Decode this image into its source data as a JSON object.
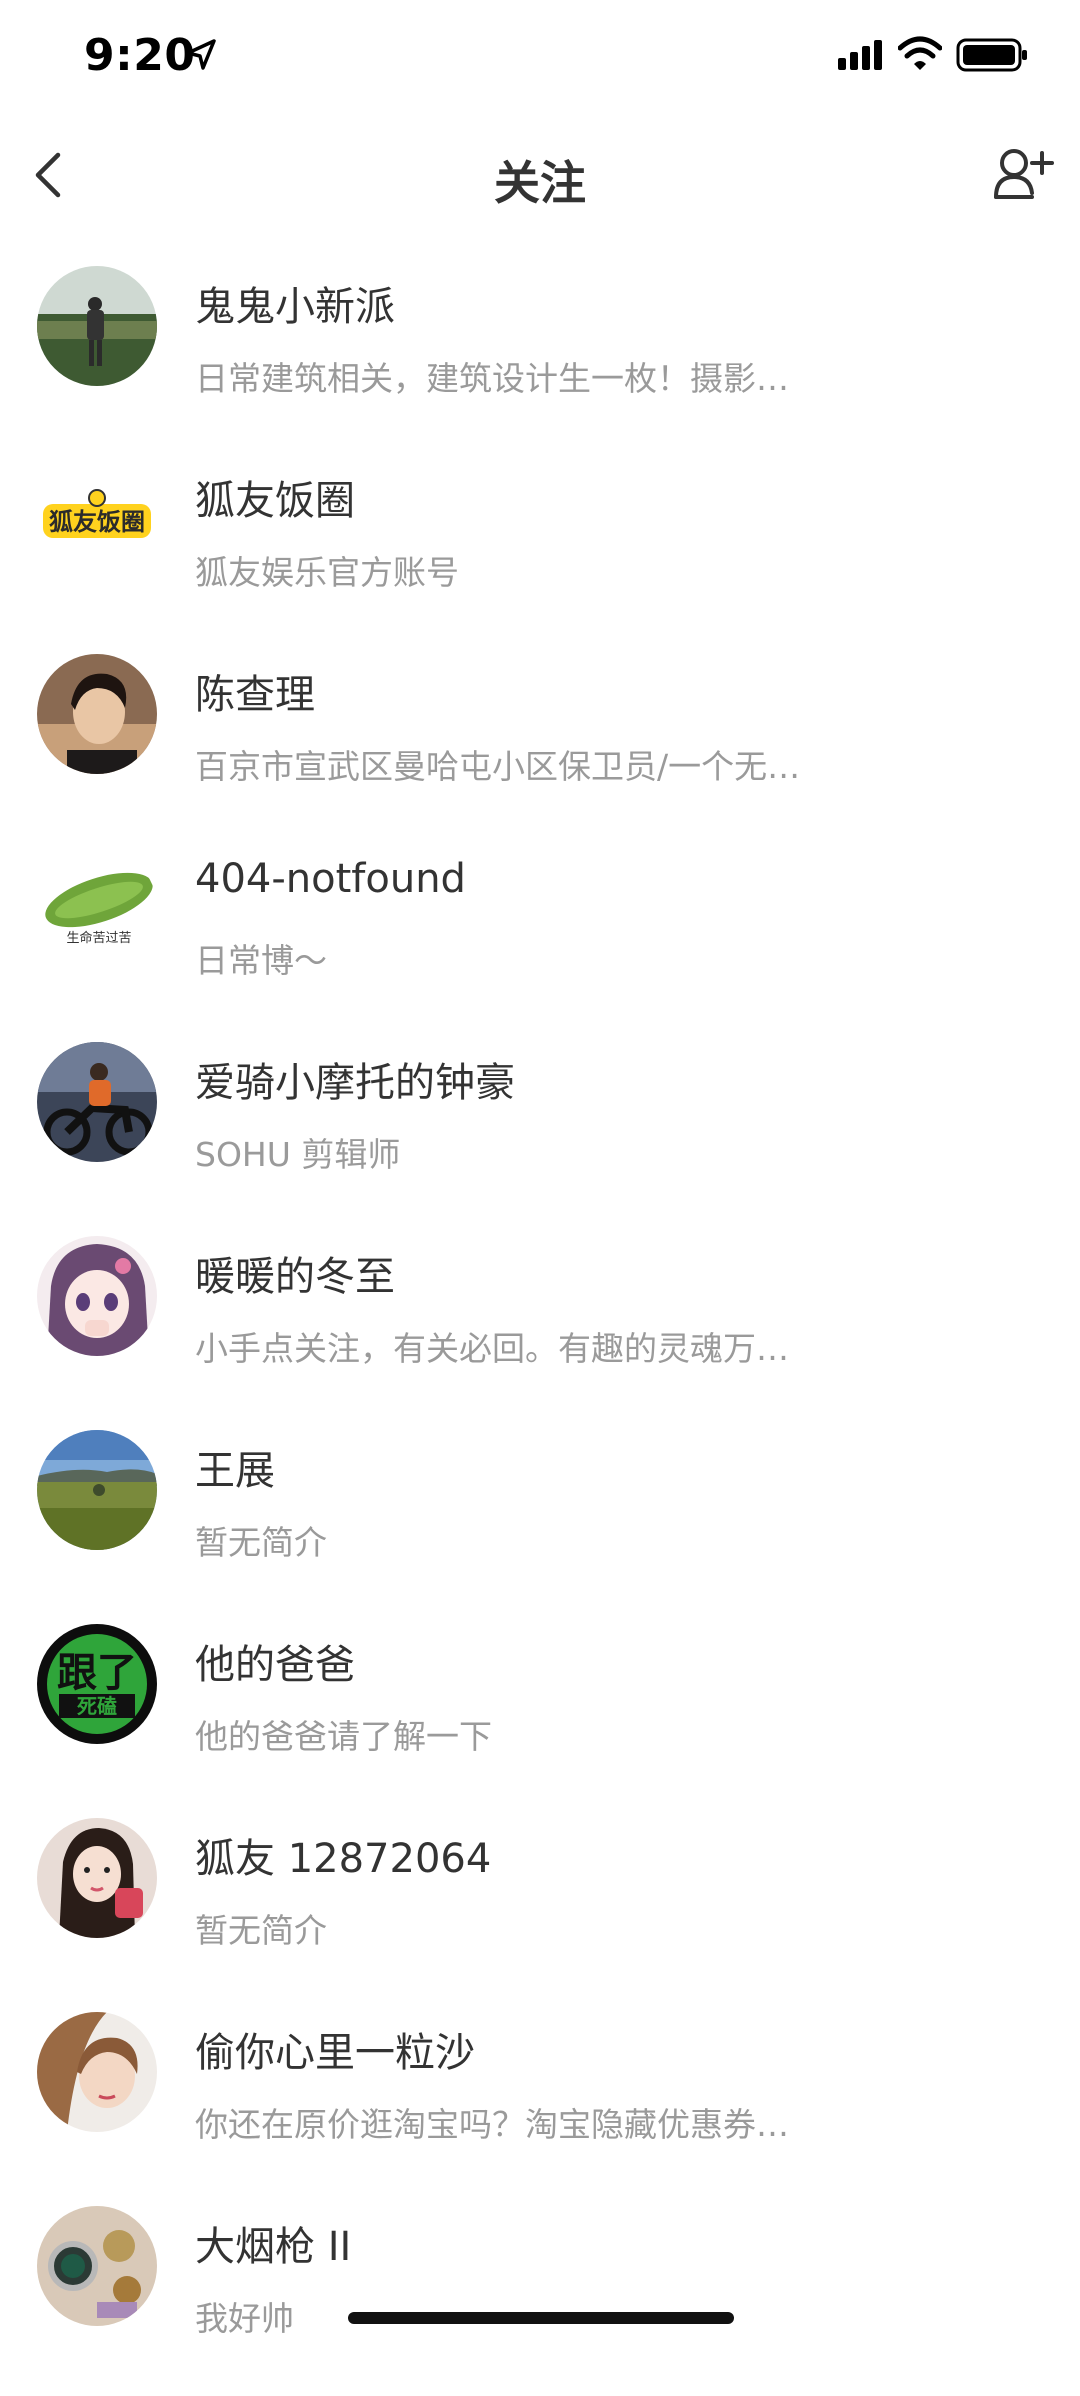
{
  "status_bar": {
    "time": "9:20"
  },
  "nav": {
    "title": "关注"
  },
  "follows": [
    {
      "name": "鬼鬼小新派",
      "bio": "日常建筑相关，建筑设计生一枚！摄影…",
      "avatar": "person-photo-avatar"
    },
    {
      "name": "狐友饭圈",
      "bio": "狐友娱乐官方账号",
      "avatar": "logo-avatar",
      "logo_text": "狐友饭圈"
    },
    {
      "name": "陈查理",
      "bio": "百京市宣武区曼哈屯小区保卫员/一个无…",
      "avatar": "portrait-avatar"
    },
    {
      "name": "404-notfound",
      "bio": "日常博～",
      "avatar": "bitter-melon-avatar",
      "avatar_caption": "生命苦过苦"
    },
    {
      "name": "爱骑小摩托的钟豪",
      "bio": "SOHU 剪辑师",
      "avatar": "motorcycle-avatar"
    },
    {
      "name": "暖暖的冬至",
      "bio": "小手点关注，有关必回。有趣的灵魂万…",
      "avatar": "anime-girl-avatar"
    },
    {
      "name": "王展",
      "bio": "暂无简介",
      "avatar": "landscape-avatar"
    },
    {
      "name": "他的爸爸",
      "bio": "他的爸爸请了解一下",
      "avatar": "text-sign-avatar",
      "avatar_text_top": "跟了",
      "avatar_text_bottom": "死磕"
    },
    {
      "name": "狐友 12872064",
      "bio": "暂无简介",
      "avatar": "selfie-avatar"
    },
    {
      "name": "偷你心里一粒沙",
      "bio": "你还在原价逛淘宝吗？淘宝隐藏优惠券…",
      "avatar": "girl-photo-avatar"
    },
    {
      "name": "大烟枪 II",
      "bio": "我好帅",
      "avatar": "watches-avatar"
    }
  ],
  "colors": {
    "text_primary": "#333333",
    "text_secondary": "#9a9a9a",
    "background": "#ffffff"
  }
}
